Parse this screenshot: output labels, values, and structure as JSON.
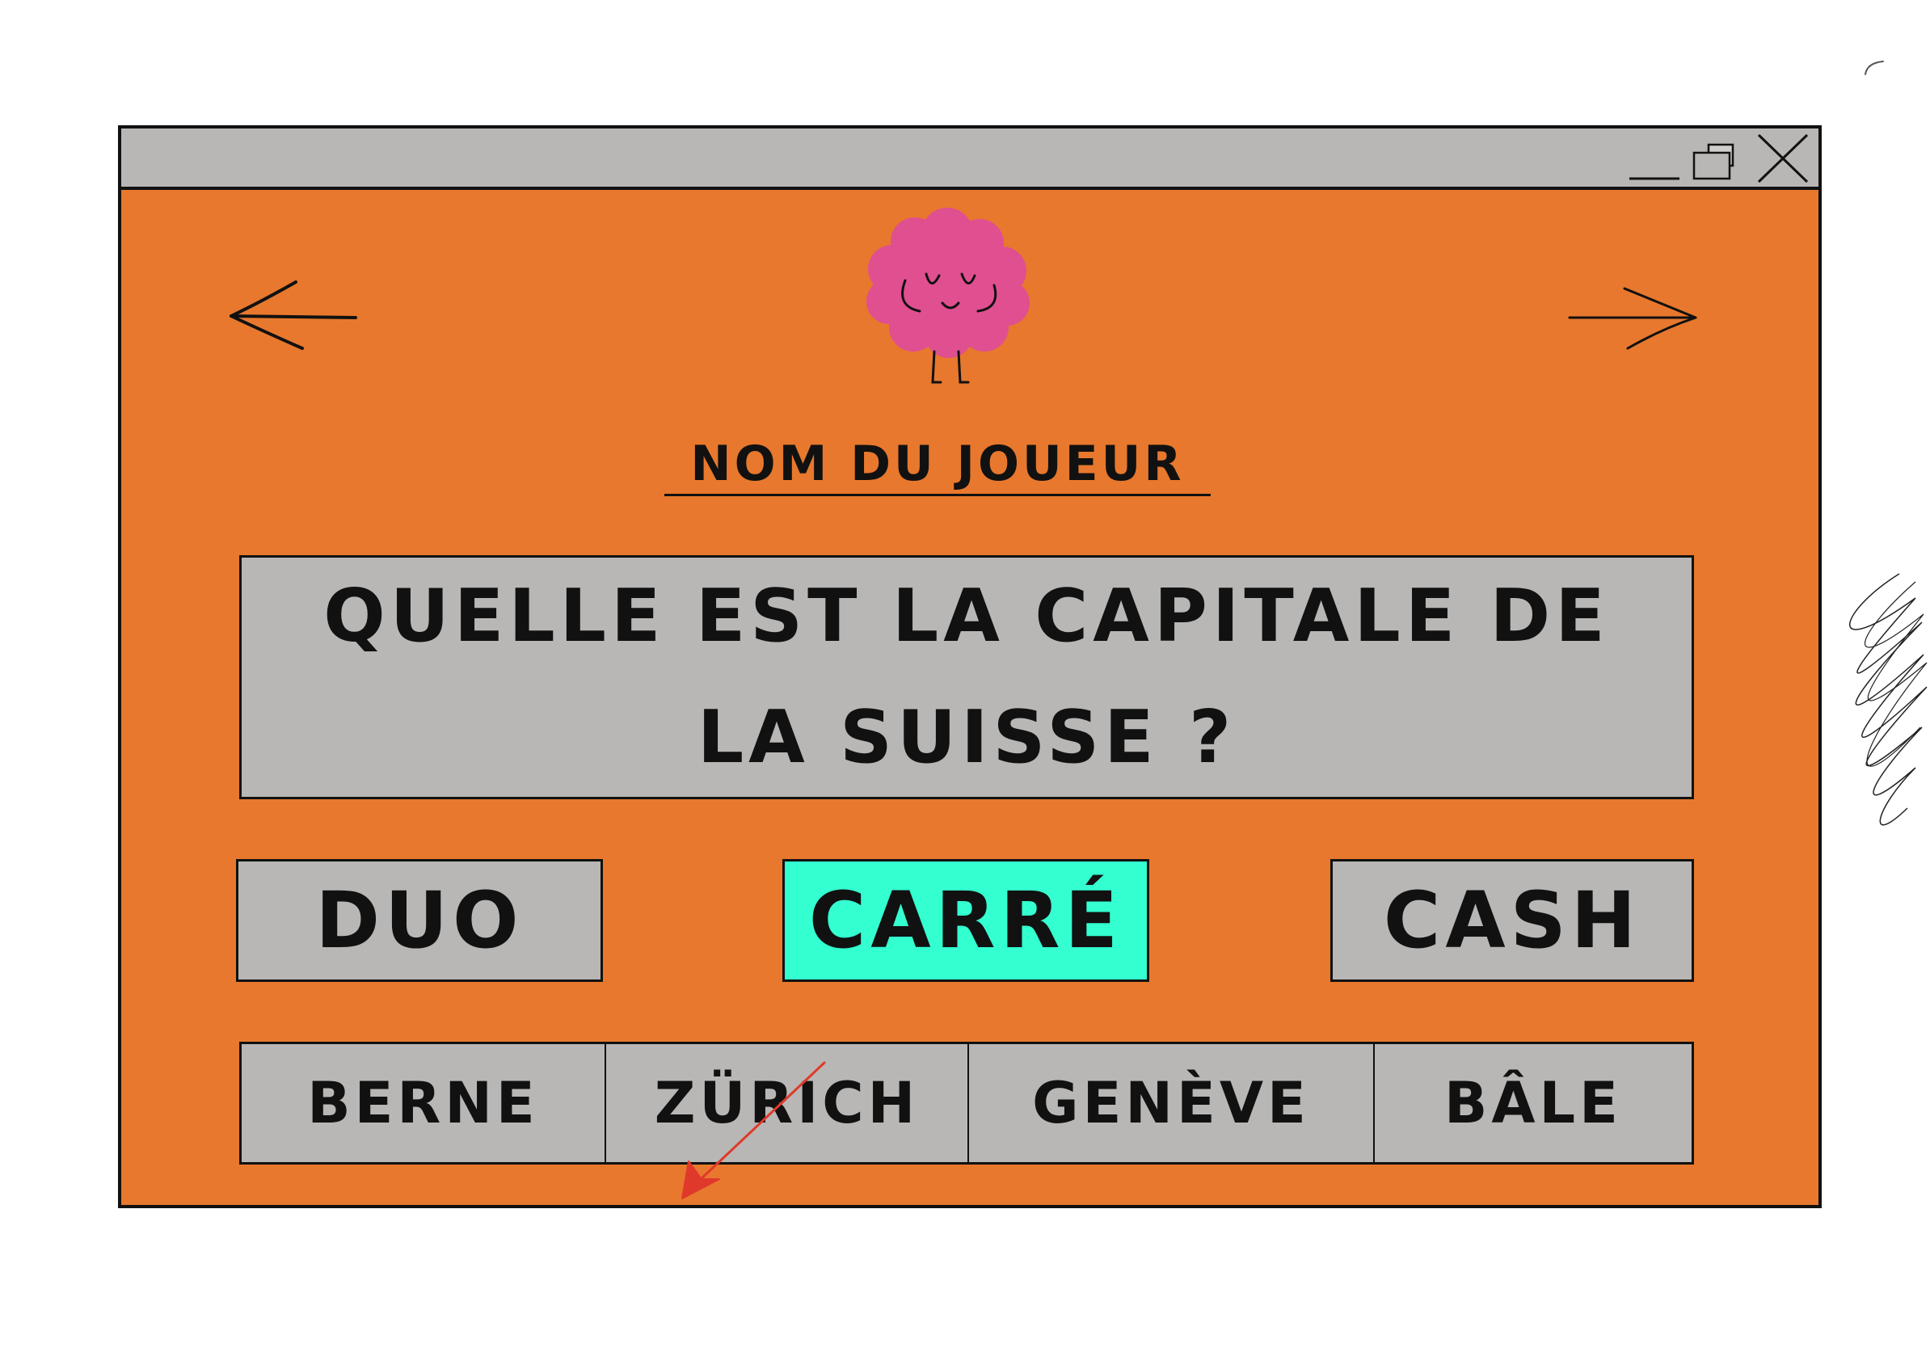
{
  "window": {
    "controls": [
      "minimize-icon",
      "maximize-icon",
      "close-icon"
    ]
  },
  "navigation": {
    "back_icon": "arrow-left-icon",
    "forward_icon": "arrow-right-icon"
  },
  "mascot": {
    "icon": "brain-mascot-icon",
    "color": "#e04f8f"
  },
  "player": {
    "name_label": "NOM DU JOUEUR"
  },
  "question": {
    "text": "QUELLE EST LA CAPITALE DE LA SUISSE ?"
  },
  "modes": {
    "duo": "DUO",
    "carre": "CARRÉ",
    "cash": "CASH",
    "selected": "carre",
    "selected_color": "#33ffd1"
  },
  "answers": [
    {
      "label": "BERNE"
    },
    {
      "label": "ZÜRICH"
    },
    {
      "label": "GENÈVE"
    },
    {
      "label": "BÂLE"
    }
  ],
  "colors": {
    "background": "#e8782d",
    "panel": "#b8b7b5",
    "annotation": "#e0382b"
  }
}
